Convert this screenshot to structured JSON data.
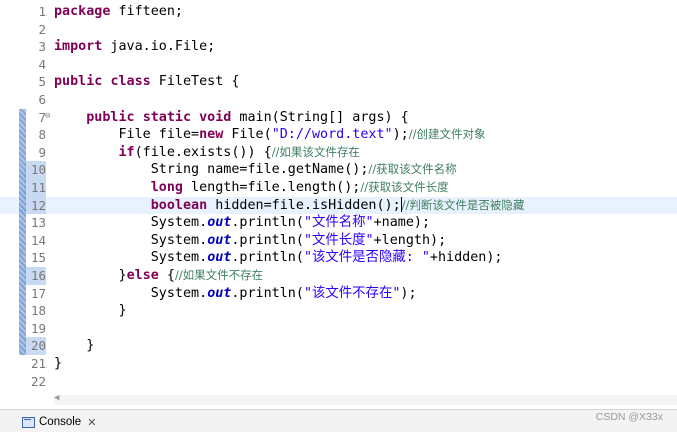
{
  "editor": {
    "lines": [
      {
        "num": "1",
        "changed": false,
        "fold": false,
        "current": false,
        "segs": [
          {
            "c": "kw",
            "t": "package"
          },
          {
            "c": "",
            "t": " fifteen;"
          }
        ]
      },
      {
        "num": "2",
        "changed": false,
        "fold": false,
        "current": false,
        "segs": []
      },
      {
        "num": "3",
        "changed": false,
        "fold": false,
        "current": false,
        "segs": [
          {
            "c": "kw",
            "t": "import"
          },
          {
            "c": "",
            "t": " java.io.File;"
          }
        ]
      },
      {
        "num": "4",
        "changed": false,
        "fold": false,
        "current": false,
        "segs": []
      },
      {
        "num": "5",
        "changed": false,
        "fold": false,
        "current": false,
        "segs": [
          {
            "c": "kw",
            "t": "public"
          },
          {
            "c": "",
            "t": " "
          },
          {
            "c": "kw",
            "t": "class"
          },
          {
            "c": "",
            "t": " FileTest {"
          }
        ]
      },
      {
        "num": "6",
        "changed": false,
        "fold": false,
        "current": false,
        "segs": []
      },
      {
        "num": "7",
        "changed": false,
        "fold": true,
        "current": false,
        "segs": [
          {
            "c": "",
            "t": "    "
          },
          {
            "c": "kw",
            "t": "public"
          },
          {
            "c": "",
            "t": " "
          },
          {
            "c": "kw",
            "t": "static"
          },
          {
            "c": "",
            "t": " "
          },
          {
            "c": "kw",
            "t": "void"
          },
          {
            "c": "",
            "t": " main(String[] args) {"
          }
        ]
      },
      {
        "num": "8",
        "changed": false,
        "fold": false,
        "current": false,
        "segs": [
          {
            "c": "",
            "t": "        File file="
          },
          {
            "c": "kw",
            "t": "new"
          },
          {
            "c": "",
            "t": " File("
          },
          {
            "c": "str",
            "t": "\"D://word.text\""
          },
          {
            "c": "",
            "t": ");"
          },
          {
            "c": "cmt",
            "t": "//创建文件对象"
          }
        ]
      },
      {
        "num": "9",
        "changed": false,
        "fold": false,
        "current": false,
        "segs": [
          {
            "c": "",
            "t": "        "
          },
          {
            "c": "kw",
            "t": "if"
          },
          {
            "c": "",
            "t": "(file.exists()) {"
          },
          {
            "c": "cmt",
            "t": "//如果该文件存在"
          }
        ]
      },
      {
        "num": "10",
        "changed": true,
        "fold": false,
        "current": false,
        "segs": [
          {
            "c": "",
            "t": "            String name=file.getName();"
          },
          {
            "c": "cmt",
            "t": "//获取该文件名称"
          }
        ]
      },
      {
        "num": "11",
        "changed": true,
        "fold": false,
        "current": false,
        "segs": [
          {
            "c": "",
            "t": "            "
          },
          {
            "c": "kw",
            "t": "long"
          },
          {
            "c": "",
            "t": " length=file.length();"
          },
          {
            "c": "cmt",
            "t": "//获取该文件长度"
          }
        ]
      },
      {
        "num": "12",
        "changed": true,
        "fold": false,
        "current": true,
        "segs": [
          {
            "c": "",
            "t": "            "
          },
          {
            "c": "kw",
            "t": "boolean"
          },
          {
            "c": "",
            "t": " hidden=file.isHidden();"
          },
          {
            "c": "cursor",
            "t": ""
          },
          {
            "c": "cmt",
            "t": "//判断该文件是否被隐藏"
          }
        ]
      },
      {
        "num": "13",
        "changed": false,
        "fold": false,
        "current": false,
        "segs": [
          {
            "c": "",
            "t": "            System."
          },
          {
            "c": "fld",
            "t": "out"
          },
          {
            "c": "",
            "t": ".println("
          },
          {
            "c": "str",
            "t": "\"文件名称\""
          },
          {
            "c": "",
            "t": "+name);"
          }
        ]
      },
      {
        "num": "14",
        "changed": false,
        "fold": false,
        "current": false,
        "segs": [
          {
            "c": "",
            "t": "            System."
          },
          {
            "c": "fld",
            "t": "out"
          },
          {
            "c": "",
            "t": ".println("
          },
          {
            "c": "str",
            "t": "\"文件长度\""
          },
          {
            "c": "",
            "t": "+length);"
          }
        ]
      },
      {
        "num": "15",
        "changed": false,
        "fold": false,
        "current": false,
        "segs": [
          {
            "c": "",
            "t": "            System."
          },
          {
            "c": "fld",
            "t": "out"
          },
          {
            "c": "",
            "t": ".println("
          },
          {
            "c": "str",
            "t": "\"该文件是否隐藏: \""
          },
          {
            "c": "",
            "t": "+hidden);"
          }
        ]
      },
      {
        "num": "16",
        "changed": true,
        "fold": false,
        "current": false,
        "segs": [
          {
            "c": "",
            "t": "        }"
          },
          {
            "c": "kw",
            "t": "else"
          },
          {
            "c": "",
            "t": " {"
          },
          {
            "c": "cmt",
            "t": "//如果文件不存在"
          }
        ]
      },
      {
        "num": "17",
        "changed": false,
        "fold": false,
        "current": false,
        "segs": [
          {
            "c": "",
            "t": "            System."
          },
          {
            "c": "fld",
            "t": "out"
          },
          {
            "c": "",
            "t": ".println("
          },
          {
            "c": "str",
            "t": "\"该文件不存在\""
          },
          {
            "c": "",
            "t": ");"
          }
        ]
      },
      {
        "num": "18",
        "changed": false,
        "fold": false,
        "current": false,
        "segs": [
          {
            "c": "",
            "t": "        }"
          }
        ]
      },
      {
        "num": "19",
        "changed": false,
        "fold": false,
        "current": false,
        "segs": []
      },
      {
        "num": "20",
        "changed": true,
        "fold": false,
        "current": false,
        "segs": [
          {
            "c": "",
            "t": "    }"
          }
        ]
      },
      {
        "num": "21",
        "changed": false,
        "fold": false,
        "current": false,
        "segs": [
          {
            "c": "",
            "t": "}"
          }
        ]
      },
      {
        "num": "22",
        "changed": false,
        "fold": false,
        "current": false,
        "segs": []
      }
    ]
  },
  "bottom_panel": {
    "console_tab_label": "Console",
    "close_symbol": "✕"
  },
  "watermark": "CSDN @X33x"
}
